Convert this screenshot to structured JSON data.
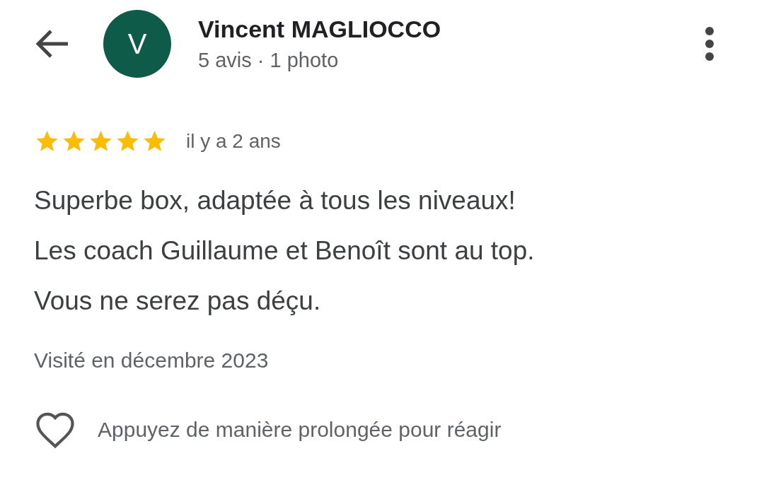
{
  "header": {
    "avatar_letter": "V",
    "name": "Vincent MAGLIOCCO",
    "subtitle": "5 avis · 1 photo"
  },
  "review": {
    "stars": 5,
    "time": "il y a 2 ans",
    "lines": [
      "Superbe box, adaptée à tous les niveaux!",
      "Les coach Guillaume et Benoît sont au top.",
      "Vous ne serez pas déçu."
    ],
    "visited": "Visité en décembre 2023"
  },
  "reaction": {
    "hint": "Appuyez de manière prolongée pour réagir"
  }
}
